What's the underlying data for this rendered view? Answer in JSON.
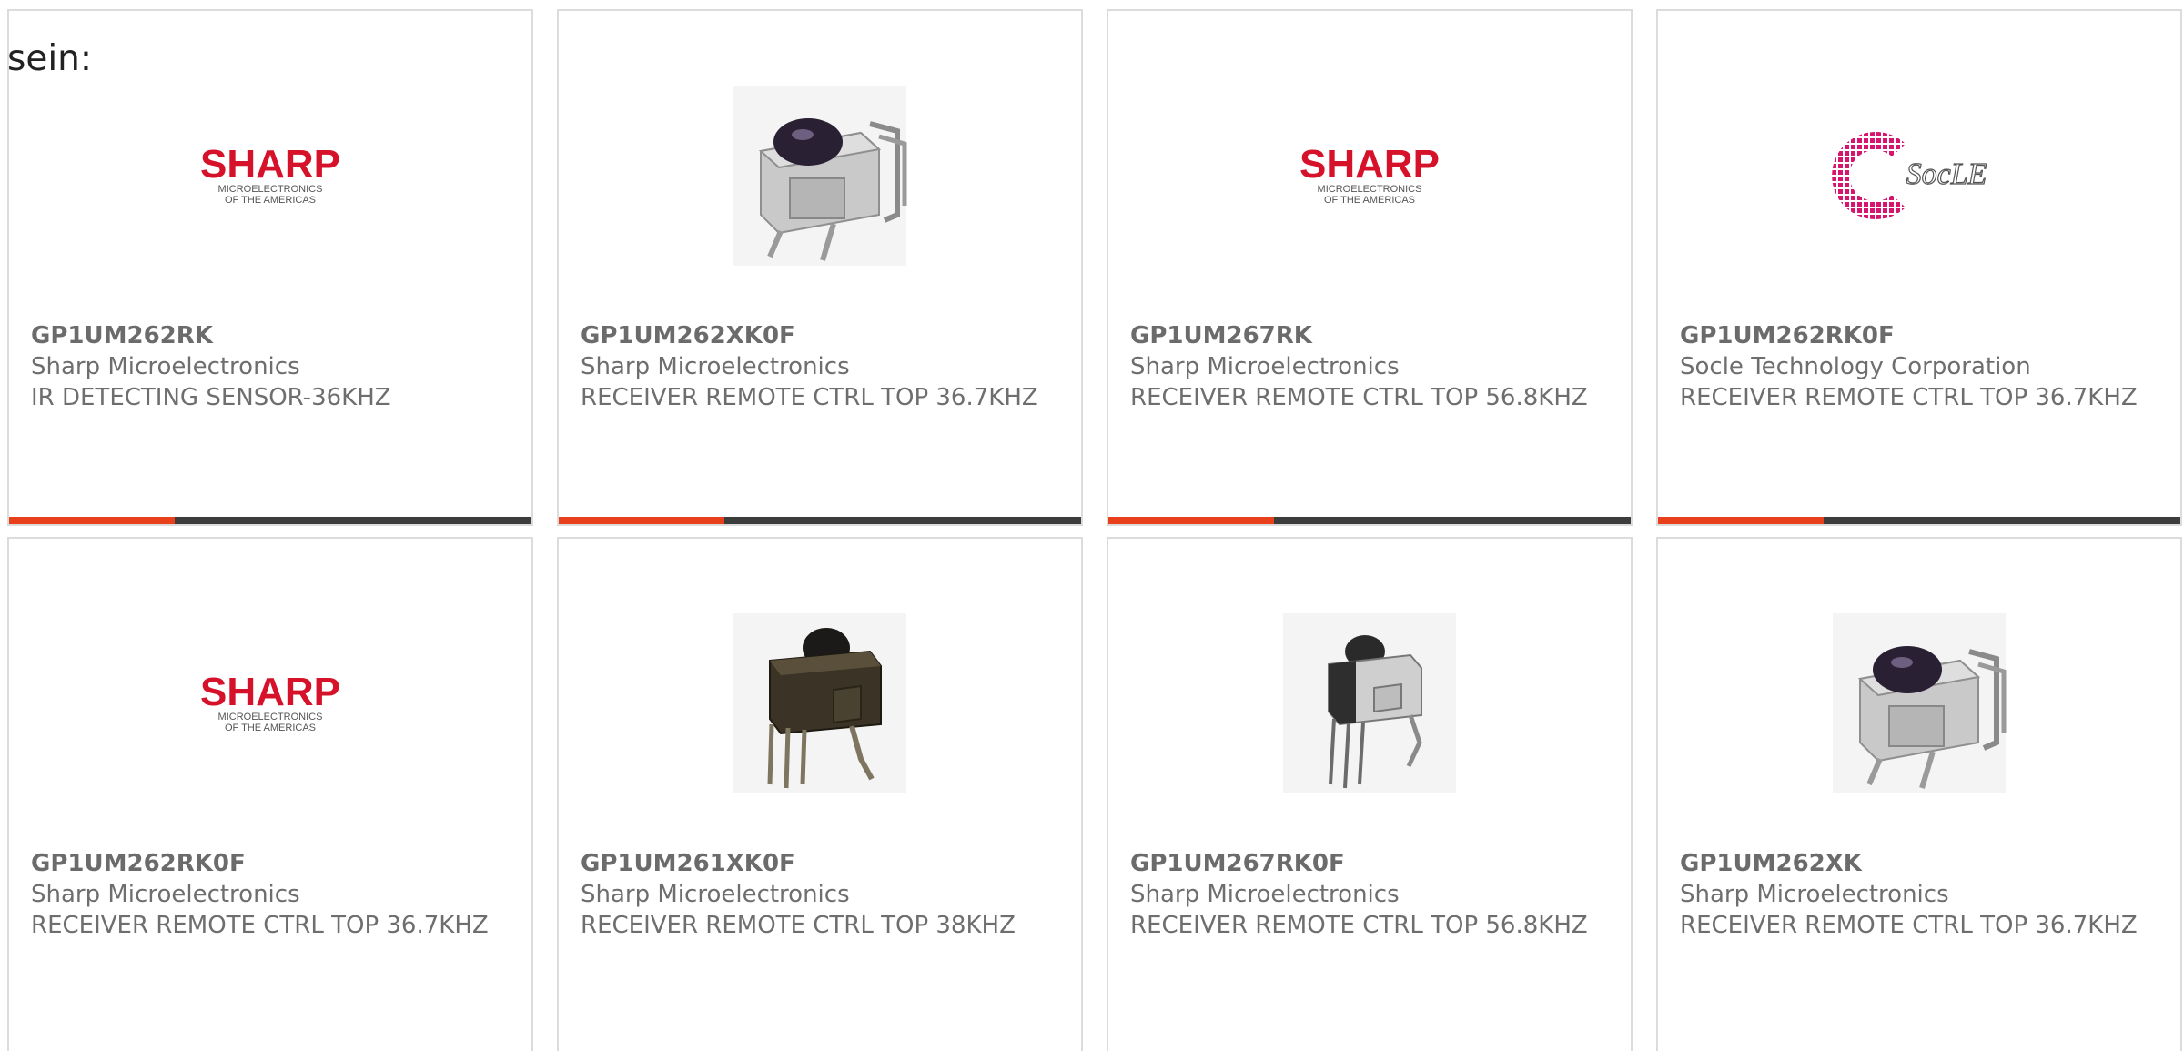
{
  "intro_text": "sein:",
  "colors": {
    "accent": "#e8401a",
    "bar": "#3c3c3c",
    "text": "#6e6e6e",
    "sharp_red": "#d6122a",
    "socle_pink": "#d6156e"
  },
  "logos": {
    "sharp": {
      "name": "SHARP",
      "line1": "MICROELECTRONICS",
      "line2": "OF THE AMERICAS"
    },
    "socle": {
      "name": "SocLE"
    }
  },
  "products": [
    {
      "part_number": "GP1UM262RK",
      "manufacturer": "Sharp Microelectronics",
      "description": "IR DETECTING SENSOR-36KHZ",
      "image": "sharp-logo"
    },
    {
      "part_number": "GP1UM262XK0F",
      "manufacturer": "Sharp Microelectronics",
      "description": "RECEIVER REMOTE CTRL TOP 36.7KHZ",
      "image": "ir-receiver-silver"
    },
    {
      "part_number": "GP1UM267RK",
      "manufacturer": "Sharp Microelectronics",
      "description": "RECEIVER REMOTE CTRL TOP 56.8KHZ",
      "image": "sharp-logo"
    },
    {
      "part_number": "GP1UM262RK0F",
      "manufacturer": "Socle Technology Corporation",
      "description": "RECEIVER REMOTE CTRL TOP 36.7KHZ",
      "image": "socle-logo"
    },
    {
      "part_number": "GP1UM262RK0F",
      "manufacturer": "Sharp Microelectronics",
      "description": "RECEIVER REMOTE CTRL TOP 36.7KHZ",
      "image": "sharp-logo"
    },
    {
      "part_number": "GP1UM261XK0F",
      "manufacturer": "Sharp Microelectronics",
      "description": "RECEIVER REMOTE CTRL TOP 38KHZ",
      "image": "ir-receiver-dark"
    },
    {
      "part_number": "GP1UM267RK0F",
      "manufacturer": "Sharp Microelectronics",
      "description": "RECEIVER REMOTE CTRL TOP 56.8KHZ",
      "image": "ir-receiver-mixed"
    },
    {
      "part_number": "GP1UM262XK",
      "manufacturer": "Sharp Microelectronics",
      "description": "RECEIVER REMOTE CTRL TOP 36.7KHZ",
      "image": "ir-receiver-silver"
    }
  ]
}
